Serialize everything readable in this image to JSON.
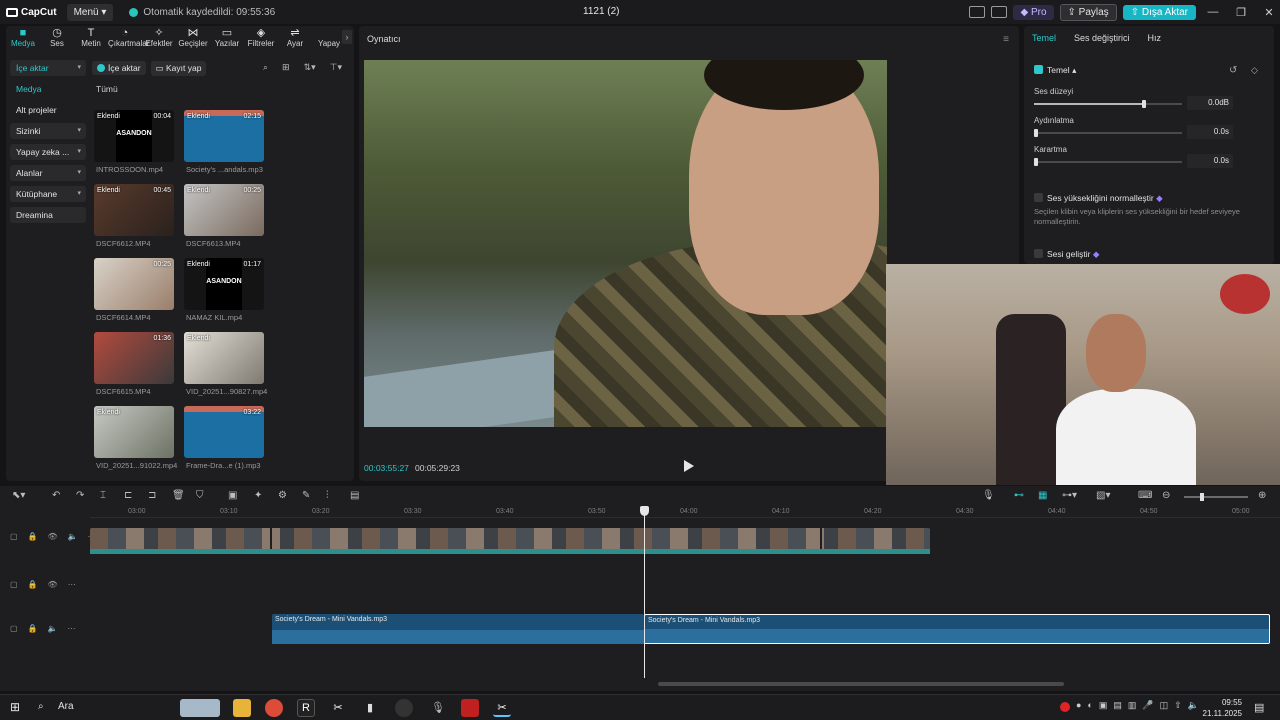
{
  "titlebar": {
    "app_name": "CapCut",
    "menu_label": "Menü",
    "autosave_text": "Otomatik kaydedildi: 09:55:36",
    "project_title": "1121 (2)",
    "pro_label": "Pro",
    "share_label": "Paylaş",
    "export_label": "Dışa Aktar"
  },
  "tool_tabs": [
    {
      "label": "Medya",
      "icon": "■"
    },
    {
      "label": "Ses",
      "icon": "◷"
    },
    {
      "label": "Metin",
      "icon": "T"
    },
    {
      "label": "Çıkartmalar",
      "icon": "◔"
    },
    {
      "label": "Efektler",
      "icon": "✧"
    },
    {
      "label": "Geçişler",
      "icon": "⋈"
    },
    {
      "label": "Yazılar",
      "icon": "▭"
    },
    {
      "label": "Filtreler",
      "icon": "◈"
    },
    {
      "label": "Ayar",
      "icon": "⇌"
    },
    {
      "label": "Yapay",
      "icon": ""
    }
  ],
  "side_nav": [
    {
      "label": "İçe aktar",
      "chev": "▾"
    },
    {
      "label": "Medya",
      "chev": ""
    },
    {
      "label": "Alt projeler",
      "chev": ""
    },
    {
      "label": "Sizinki",
      "chev": "▾"
    },
    {
      "label": "Yapay zeka ...",
      "chev": "▾"
    },
    {
      "label": "Alanlar",
      "chev": "▾"
    },
    {
      "label": "Kütüphane",
      "chev": "▾"
    },
    {
      "label": "Dreamina",
      "chev": ""
    }
  ],
  "media_toolbar": {
    "import_label": "İçe aktar",
    "record_label": "Kayıt yap",
    "all_label": "Tümü"
  },
  "media_items": [
    {
      "name": "INTROSSOON.mp4",
      "tag": "Eklendi",
      "duration": "00:04",
      "overlay": "ASANDON"
    },
    {
      "name": "Society's ...andals.mp3",
      "tag": "Eklendi",
      "duration": "02:15",
      "overlay": ""
    },
    {
      "name": "DSCF6612.MP4",
      "tag": "Eklendi",
      "duration": "00:45",
      "overlay": ""
    },
    {
      "name": "DSCF6613.MP4",
      "tag": "Eklendi",
      "duration": "00:25",
      "overlay": ""
    },
    {
      "name": "DSCF6614.MP4",
      "tag": "",
      "duration": "00:25",
      "overlay": ""
    },
    {
      "name": "NAMAZ KIL.mp4",
      "tag": "Eklendi",
      "duration": "01:17",
      "overlay": "ASANDON"
    },
    {
      "name": "DSCF6615.MP4",
      "tag": "",
      "duration": "01:36",
      "overlay": ""
    },
    {
      "name": "VID_20251...90827.mp4",
      "tag": "Eklendi",
      "duration": "",
      "overlay": ""
    },
    {
      "name": "VID_20251...91022.mp4",
      "tag": "Eklendi",
      "duration": "",
      "overlay": ""
    },
    {
      "name": "Frame-Dra...e (1).mp3",
      "tag": "",
      "duration": "03:22",
      "overlay": ""
    }
  ],
  "player": {
    "title": "Oynatıcı",
    "current_time": "00:03:55:27",
    "total_time": "00:05:29:23"
  },
  "right_panel": {
    "tabs": [
      "Temel",
      "Ses değiştirici",
      "Hız"
    ],
    "section_title": "Temel",
    "sliders": [
      {
        "label": "Ses düzeyi",
        "value": "0.0dB",
        "level": 0.74
      },
      {
        "label": "Aydınlatma",
        "value": "0.0s",
        "level": 0.0
      },
      {
        "label": "Karartma",
        "value": "0.0s",
        "level": 0.0
      }
    ],
    "normalize_label": "Ses yüksekliğini normalleştir",
    "normalize_desc": "Seçilen klibin veya kliplerin ses yüksekliğini bir hedef seviyeye normalleştirin.",
    "enhance_label": "Sesi geliştir"
  },
  "timeline": {
    "ticks": [
      "03:00",
      "03:10",
      "03:20",
      "03:30",
      "03:40",
      "03:50",
      "04:00",
      "04:10",
      "04:20",
      "04:30",
      "04:40",
      "04:50",
      "05:00"
    ],
    "audio_clip_1": "Society's Dream - Mini Vandals.mp3",
    "audio_clip_2": "Society's Dream - Mini Vandals.mp3"
  },
  "taskbar": {
    "search_label": "Ara",
    "time": "09:55",
    "date": "21.11.2025"
  }
}
